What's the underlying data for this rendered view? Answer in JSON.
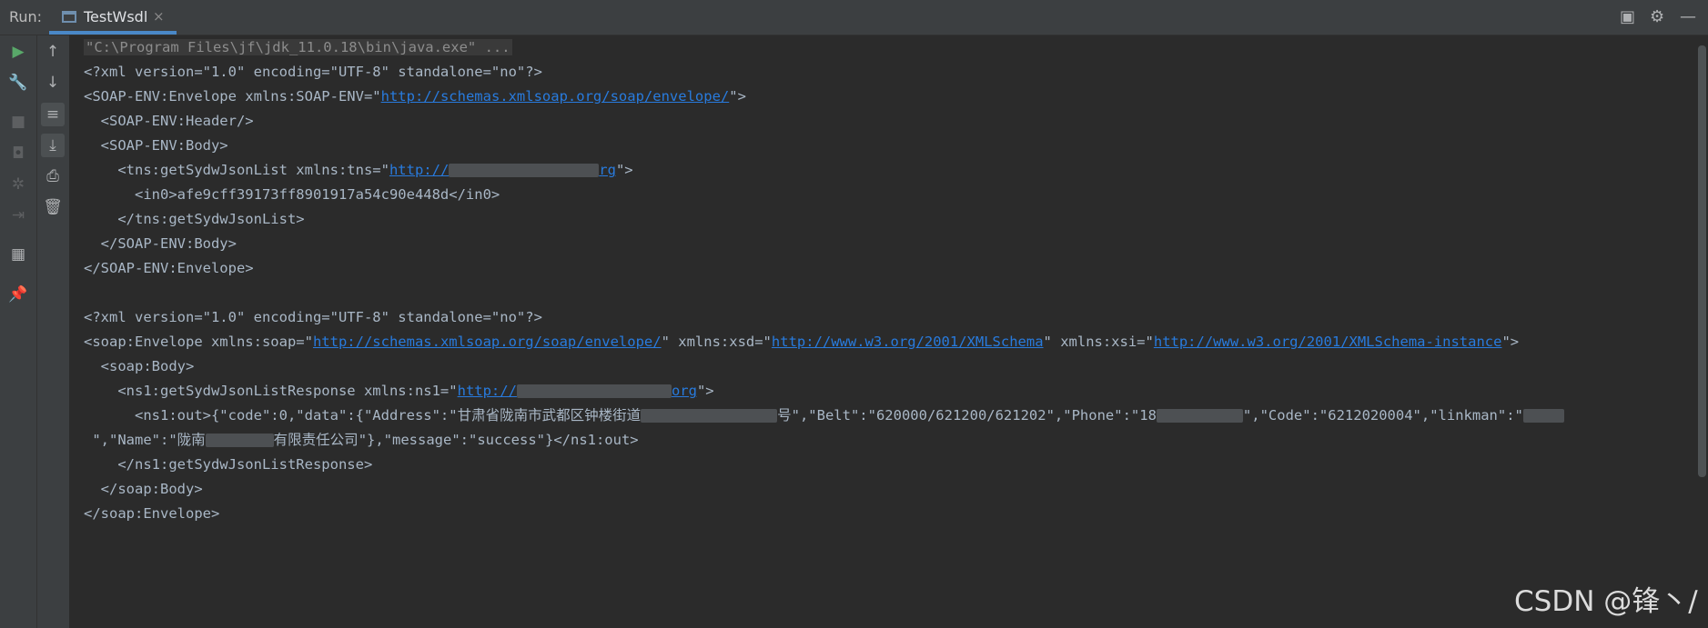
{
  "toolbar": {
    "run_label": "Run:",
    "tab_title": "TestWsdl",
    "tab_close": "×",
    "layout_icon": "▣",
    "gear_icon": "⚙",
    "minimize_icon": "—"
  },
  "gutter": {
    "rerun": "▶",
    "wrench": "🔧",
    "stop": "■",
    "camera": "◘",
    "bug": "✲",
    "login": "⇥",
    "layout": "▦",
    "pin": "📌",
    "up": "↑",
    "down": "↓",
    "softwrap": "≡",
    "scroll_end": "⤓",
    "print": "⎙",
    "trash": "🗑"
  },
  "console": {
    "cmd": "\"C:\\Program Files\\jf\\jdk_11.0.18\\bin\\java.exe\" ...",
    "l2": "<?xml version=\"1.0\" encoding=\"UTF-8\" standalone=\"no\"?>",
    "l3a": "<SOAP-ENV:Envelope xmlns:SOAP-ENV=\"",
    "l3link": "http://schemas.xmlsoap.org/soap/envelope/",
    "l3b": "\">",
    "l4": "  <SOAP-ENV:Header/>",
    "l5": "  <SOAP-ENV:Body>",
    "l6a": "    <tns:getSydwJsonList xmlns:tns=\"",
    "l6link_a": "http://",
    "l6link_b": "rg",
    "l6b": "\">",
    "l7": "      <in0>afe9cff39173ff8901917a54c90e448d</in0>",
    "l8": "    </tns:getSydwJsonList>",
    "l9": "  </SOAP-ENV:Body>",
    "l10": "</SOAP-ENV:Envelope>",
    "l12": "<?xml version=\"1.0\" encoding=\"UTF-8\" standalone=\"no\"?>",
    "l13a": "<soap:Envelope xmlns:soap=\"",
    "l13link1": "http://schemas.xmlsoap.org/soap/envelope/",
    "l13b": "\" xmlns:xsd=\"",
    "l13link2": "http://www.w3.org/2001/XMLSchema",
    "l13c": "\" xmlns:xsi=\"",
    "l13link3": "http://www.w3.org/2001/XMLSchema-instance",
    "l13d": "\">",
    "l14": "  <soap:Body>",
    "l15a": "    <ns1:getSydwJsonListResponse xmlns:ns1=\"",
    "l15link_a": "http://",
    "l15link_b": "org",
    "l15b": "\">",
    "l16a": "      <ns1:out>{\"code\":0,\"data\":{\"Address\":\"",
    "l16cn1": "甘肃省陇南市武都区钟楼街道",
    "l16cn2": "号",
    "l16b": "\",\"Belt\":\"620000/621200/621202\",\"Phone\":\"18",
    "l16c": "\",\"Code\":\"6212020004\",\"linkman\":\"",
    "l17a": " \",\"Name\":\"",
    "l17cn1": "陇南",
    "l17cn2": "有限责任公司",
    "l17b": "\"},\"message\":\"success\"}</ns1:out>",
    "l18": "    </ns1:getSydwJsonListResponse>",
    "l19": "  </soap:Body>",
    "l20": "</soap:Envelope>"
  },
  "watermark": "CSDN @锋丶/"
}
